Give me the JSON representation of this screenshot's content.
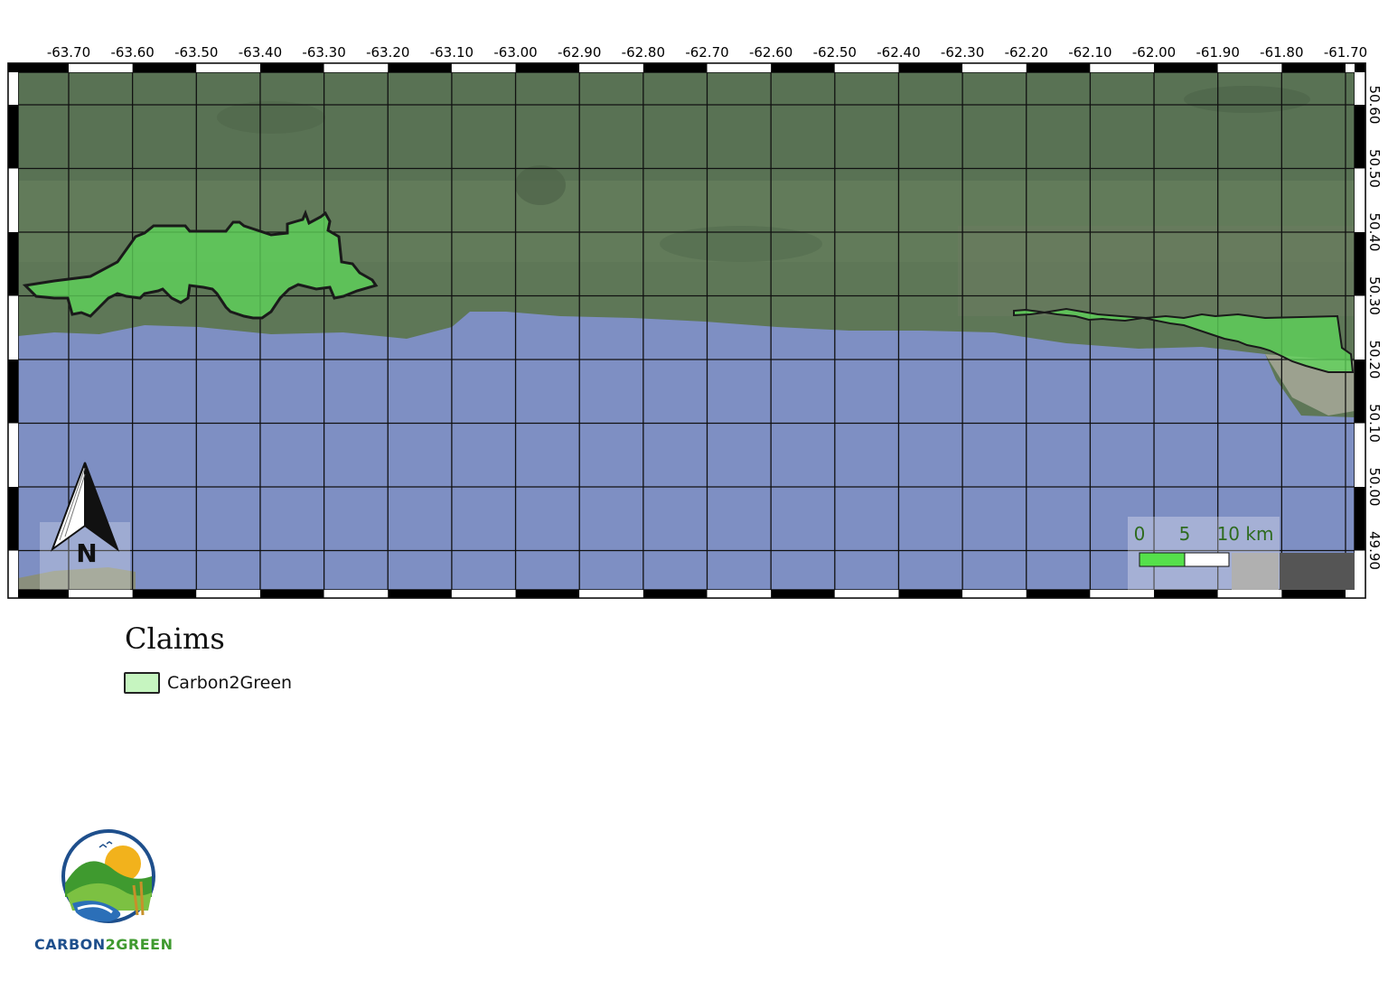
{
  "map": {
    "lon_ticks": [
      "-63.70",
      "-63.60",
      "-63.50",
      "-63.40",
      "-63.30",
      "-63.20",
      "-63.10",
      "-63.00",
      "-62.90",
      "-62.80",
      "-62.70",
      "-62.60",
      "-62.50",
      "-62.40",
      "-62.30",
      "-62.20",
      "-62.10",
      "-62.00",
      "-61.90",
      "-61.80",
      "-61.70"
    ],
    "lat_ticks": [
      "50.60",
      "50.50",
      "50.40",
      "50.30",
      "50.20",
      "50.10",
      "50.00",
      "49.90"
    ],
    "colors": {
      "land": "#5f7a5a",
      "water": "#7f90c4",
      "claim_fill": "#5fd65a",
      "claim_stroke": "#1a1a1a",
      "grid": "#111111"
    },
    "north_arrow_label": "N",
    "scale_bar": {
      "labels": [
        "0",
        "5",
        "10 km"
      ],
      "label_color": "#2e6b1e",
      "fill": "#55e04b"
    }
  },
  "legend": {
    "title": "Claims",
    "items": [
      {
        "label": "Carbon2Green",
        "color": "#c6f5c0"
      }
    ]
  },
  "logo": {
    "text_part1": "CARBON",
    "text_part2": "2GREEN"
  }
}
